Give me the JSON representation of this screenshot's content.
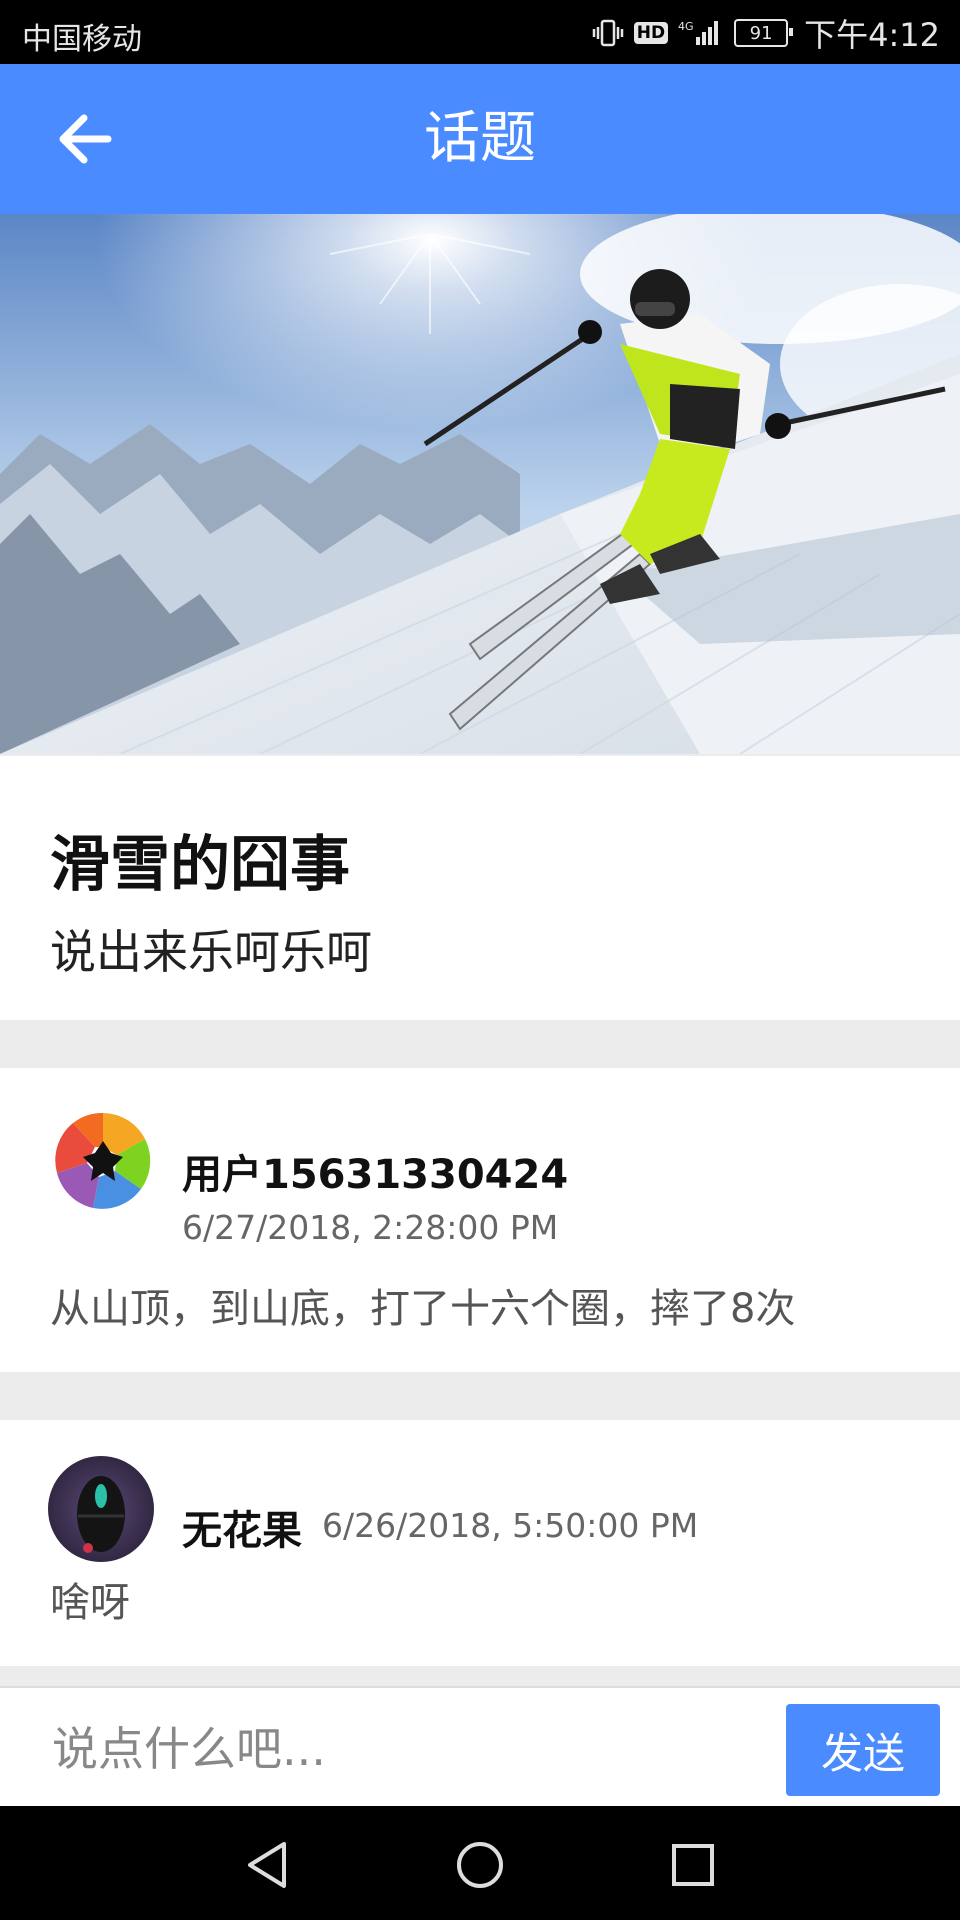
{
  "status_bar": {
    "carrier": "中国移动",
    "network": "4G",
    "hd": "HD",
    "battery": "91",
    "time": "下午4:12"
  },
  "app_bar": {
    "title": "话题"
  },
  "topic": {
    "title": "滑雪的囧事",
    "subtitle": "说出来乐呵乐呵"
  },
  "comments": [
    {
      "user": "用户15631330424",
      "time": "6/27/2018, 2:28:00 PM",
      "text": "从山顶，到山底，打了十六个圈，摔了8次"
    },
    {
      "user": "无花果",
      "time": "6/26/2018, 5:50:00 PM",
      "text": "啥呀"
    }
  ],
  "input": {
    "placeholder": "说点什么吧...",
    "value": ""
  },
  "send_button": {
    "label": "发送"
  },
  "nav": {
    "icons": [
      "back-triangle-icon",
      "home-circle-icon",
      "recents-square-icon"
    ]
  },
  "colors": {
    "primary": "#4a8cff",
    "divider": "#ececec"
  }
}
